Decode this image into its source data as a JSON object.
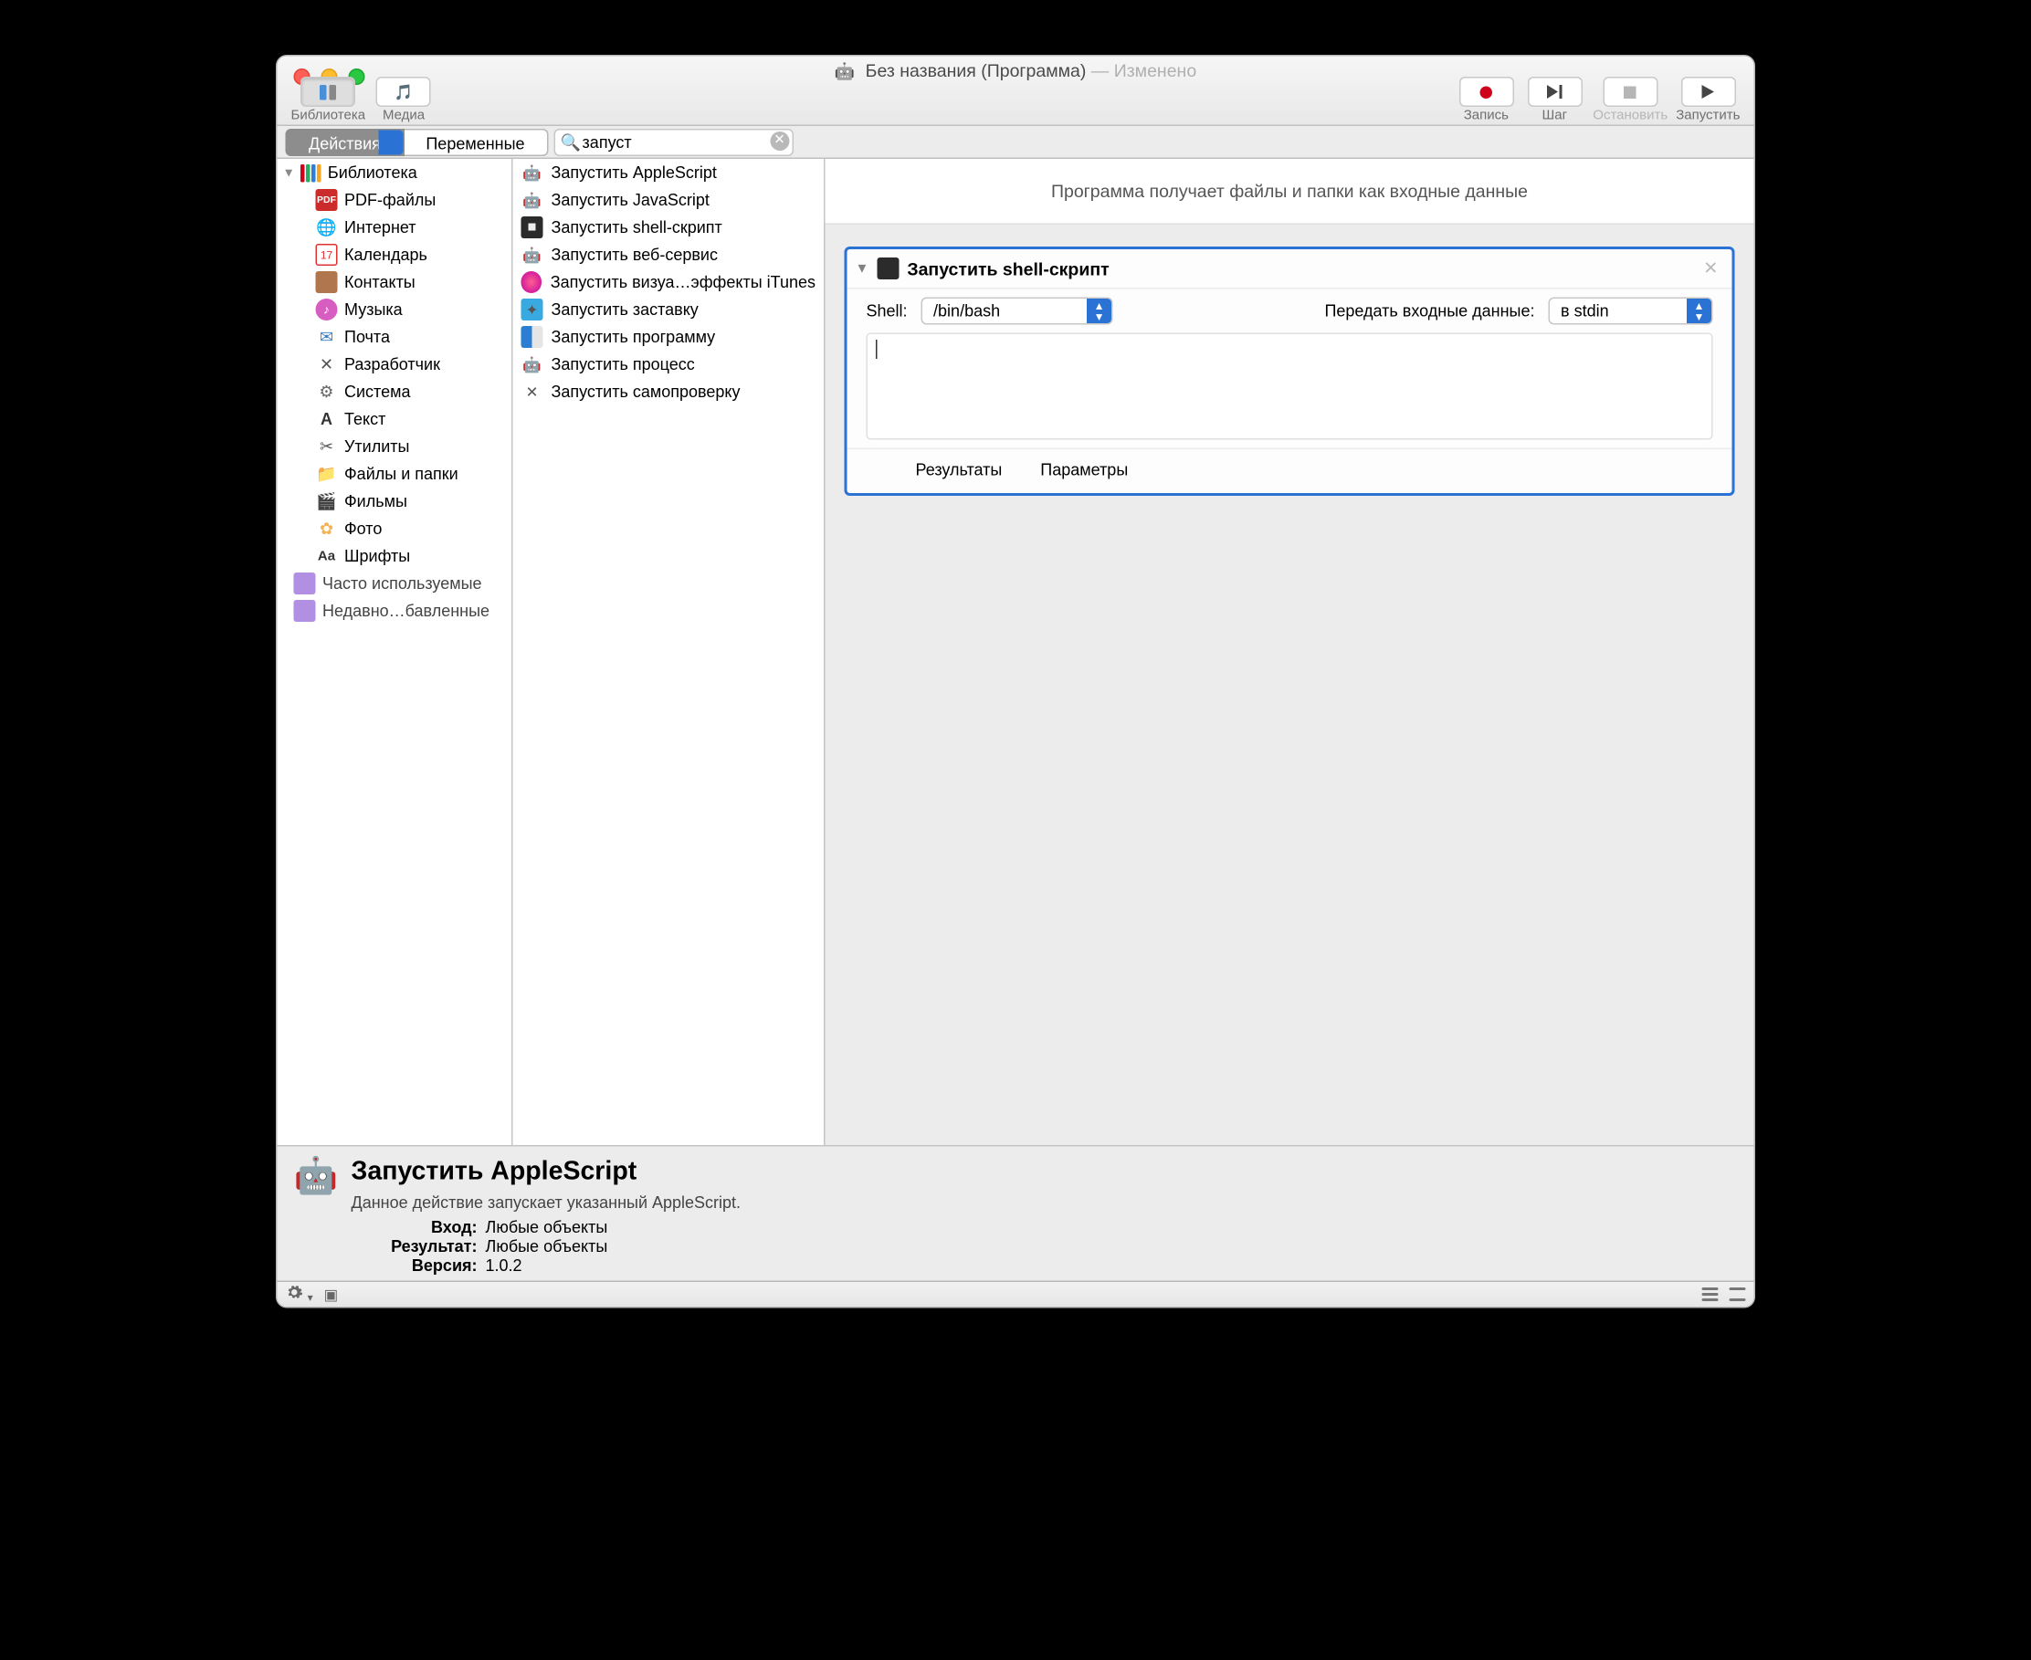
{
  "window": {
    "title_main": "Без названия (Программа)",
    "title_modified": "— Изменено"
  },
  "toolbar": {
    "library": "Библиотека",
    "media": "Медиа",
    "record": "Запись",
    "step": "Шаг",
    "stop": "Остановить",
    "run": "Запустить"
  },
  "segmented": {
    "actions": "Действия",
    "variables": "Переменные"
  },
  "search": {
    "value": "запуст"
  },
  "library": {
    "root": "Библиотека",
    "items": [
      {
        "label": "PDF-файлы",
        "icon": "pdf"
      },
      {
        "label": "Интернет",
        "icon": "globe"
      },
      {
        "label": "Календарь",
        "icon": "cal"
      },
      {
        "label": "Контакты",
        "icon": "book"
      },
      {
        "label": "Музыка",
        "icon": "music"
      },
      {
        "label": "Почта",
        "icon": "mail"
      },
      {
        "label": "Разработчик",
        "icon": "dev"
      },
      {
        "label": "Система",
        "icon": "gear"
      },
      {
        "label": "Текст",
        "icon": "txt"
      },
      {
        "label": "Утилиты",
        "icon": "util"
      },
      {
        "label": "Файлы и папки",
        "icon": "folderico"
      },
      {
        "label": "Фильмы",
        "icon": "movie"
      },
      {
        "label": "Фото",
        "icon": "photo"
      },
      {
        "label": "Шрифты",
        "icon": "font"
      }
    ],
    "folders": [
      {
        "label": "Часто используемые"
      },
      {
        "label": "Недавно…бавленные"
      }
    ]
  },
  "actions": [
    {
      "label": "Запустить AppleScript",
      "icon": "robot"
    },
    {
      "label": "Запустить JavaScript",
      "icon": "robot"
    },
    {
      "label": "Запустить shell-скрипт",
      "icon": "term"
    },
    {
      "label": "Запустить веб-сервис",
      "icon": "robot"
    },
    {
      "label": "Запустить визуа…эффекты iTunes",
      "icon": "itunes"
    },
    {
      "label": "Запустить заставку",
      "icon": "shimmer"
    },
    {
      "label": "Запустить программу",
      "icon": "finder"
    },
    {
      "label": "Запустить процесс",
      "icon": "robot"
    },
    {
      "label": "Запустить самопроверку",
      "icon": "gearwrench"
    }
  ],
  "canvas": {
    "hint": "Программа получает файлы и папки как входные данные",
    "action_title": "Запустить shell-скрипт",
    "shell_label": "Shell:",
    "shell_value": "/bin/bash",
    "pass_label": "Передать входные данные:",
    "pass_value": "в stdin",
    "code": "",
    "tabs": {
      "results": "Результаты",
      "params": "Параметры"
    }
  },
  "info": {
    "title": "Запустить AppleScript",
    "desc": "Данное действие запускает указанный AppleScript.",
    "input_k": "Вход:",
    "input_v": "Любые объекты",
    "result_k": "Результат:",
    "result_v": "Любые объекты",
    "version_k": "Версия:",
    "version_v": "1.0.2"
  }
}
